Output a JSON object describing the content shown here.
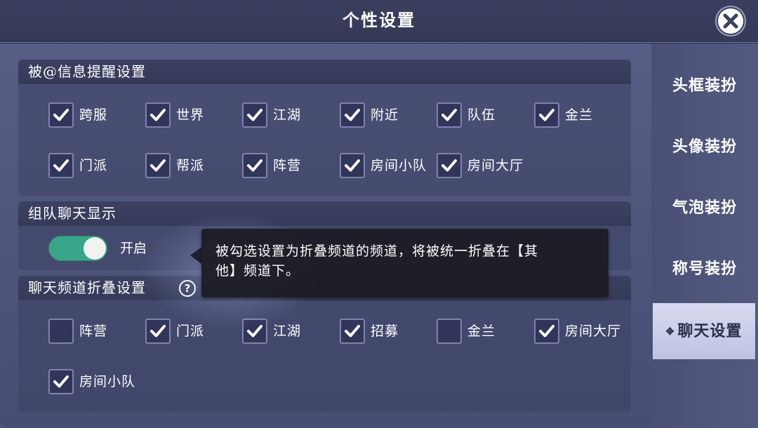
{
  "window": {
    "title": "个性设置"
  },
  "icons": {
    "close": "close-icon",
    "check": "check-icon",
    "help": "help-icon",
    "active_marker": "diamond-icon"
  },
  "colors": {
    "toggle_on": "#3aa689",
    "active_tab_bg": "#c9cce8",
    "tooltip_bg": "#1c1c24"
  },
  "sidebar": {
    "items": [
      {
        "label": "头框装扮",
        "active": false
      },
      {
        "label": "头像装扮",
        "active": false
      },
      {
        "label": "气泡装扮",
        "active": false
      },
      {
        "label": "称号装扮",
        "active": false
      },
      {
        "label": "聊天设置",
        "active": true
      }
    ]
  },
  "mention_section": {
    "title": "被@信息提醒设置",
    "options": [
      {
        "label": "跨服",
        "checked": true
      },
      {
        "label": "世界",
        "checked": true
      },
      {
        "label": "江湖",
        "checked": true
      },
      {
        "label": "附近",
        "checked": true
      },
      {
        "label": "队伍",
        "checked": true
      },
      {
        "label": "金兰",
        "checked": true
      },
      {
        "label": "门派",
        "checked": true
      },
      {
        "label": "帮派",
        "checked": true
      },
      {
        "label": "阵营",
        "checked": true
      },
      {
        "label": "房间小队",
        "checked": true
      },
      {
        "label": "房间大厅",
        "checked": true
      }
    ]
  },
  "team_section": {
    "title": "组队聊天显示",
    "toggle": {
      "label": "开启",
      "on": true
    }
  },
  "fold_section": {
    "title": "聊天频道折叠设置",
    "help": "?",
    "options": [
      {
        "label": "阵营",
        "checked": false
      },
      {
        "label": "门派",
        "checked": true
      },
      {
        "label": "江湖",
        "checked": true
      },
      {
        "label": "招募",
        "checked": true
      },
      {
        "label": "金兰",
        "checked": false
      },
      {
        "label": "房间大厅",
        "checked": true
      },
      {
        "label": "房间小队",
        "checked": true
      }
    ]
  },
  "tooltip": {
    "line1": "被勾选设置为折叠频道的频道，将被统一折叠在【其",
    "line2": "他】频道下。"
  }
}
